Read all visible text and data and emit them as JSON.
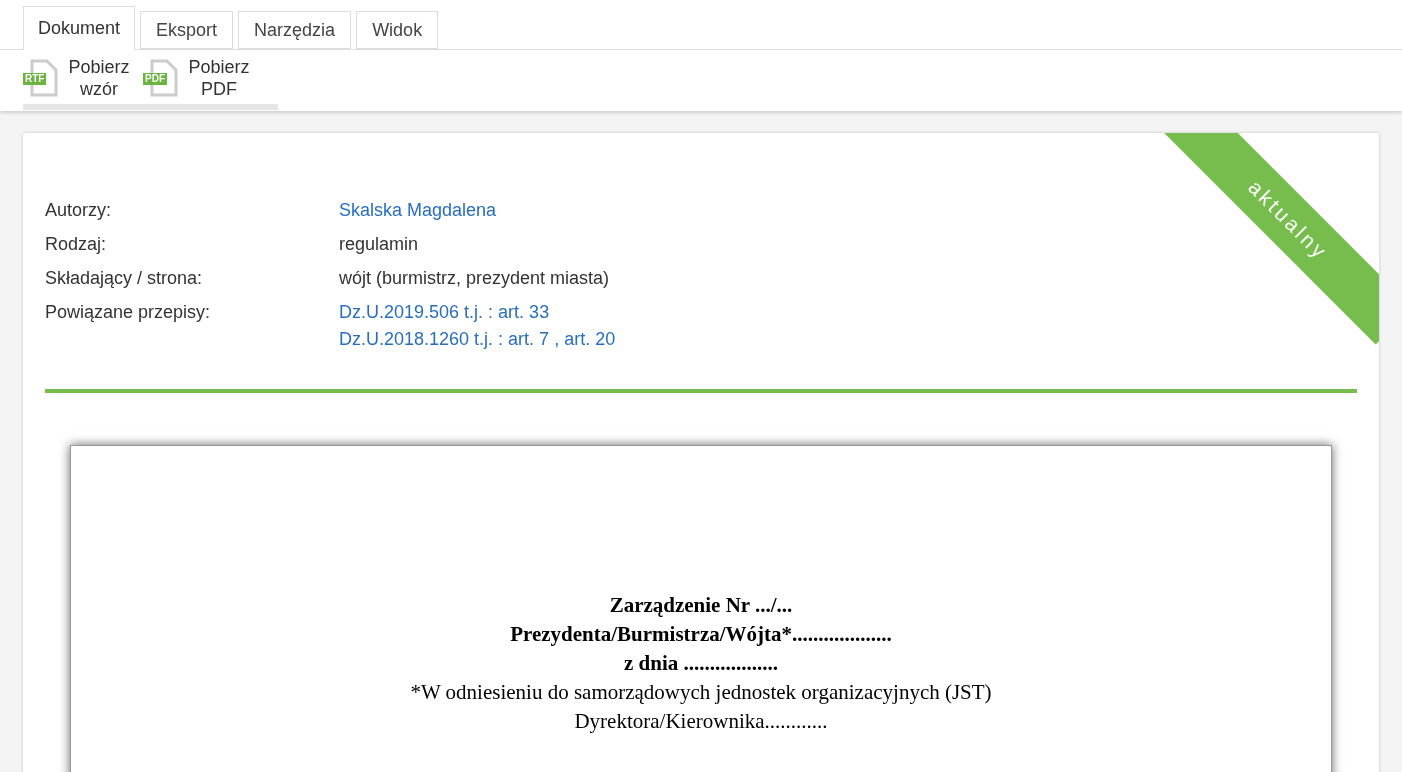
{
  "tabs": [
    {
      "label": "Dokument",
      "selected": true
    },
    {
      "label": "Eksport",
      "selected": false
    },
    {
      "label": "Narzędzia",
      "selected": false
    },
    {
      "label": "Widok",
      "selected": false
    }
  ],
  "toolbar": [
    {
      "badge": "RTF",
      "label": "Pobierz wzór"
    },
    {
      "badge": "PDF",
      "label": "Pobierz PDF"
    }
  ],
  "status_ribbon": "aktualny",
  "details": [
    {
      "label": "Autorzy:",
      "kind": "link",
      "value": "Skalska Magdalena"
    },
    {
      "label": "Rodzaj:",
      "kind": "text",
      "value": "regulamin"
    },
    {
      "label": "Składający / strona:",
      "kind": "text",
      "value": "wójt (burmistrz, prezydent miasta)"
    },
    {
      "label": "Powiązane przepisy:",
      "kind": "refs",
      "lines": [
        {
          "act": "Dz.U.2019.506 t.j.",
          "act_sep": ":",
          "articles": [
            "art. 33"
          ]
        },
        {
          "act": "Dz.U.2018.1260 t.j.",
          "act_sep": ":",
          "articles": [
            "art. 7",
            "art. 20"
          ],
          "article_sep": ","
        }
      ]
    }
  ],
  "document": {
    "lines": [
      {
        "text": "Zarządzenie Nr .../...",
        "bold": true
      },
      {
        "text": "Prezydenta/Burmistrza/Wójta*...................",
        "bold": true
      },
      {
        "text": "z dnia ..................",
        "bold": true
      },
      {
        "text": "*W odniesieniu do samorządowych jednostek organizacyjnych (JST)",
        "bold": false
      },
      {
        "text": "Dyrektora/Kierownika............",
        "bold": false
      }
    ]
  }
}
